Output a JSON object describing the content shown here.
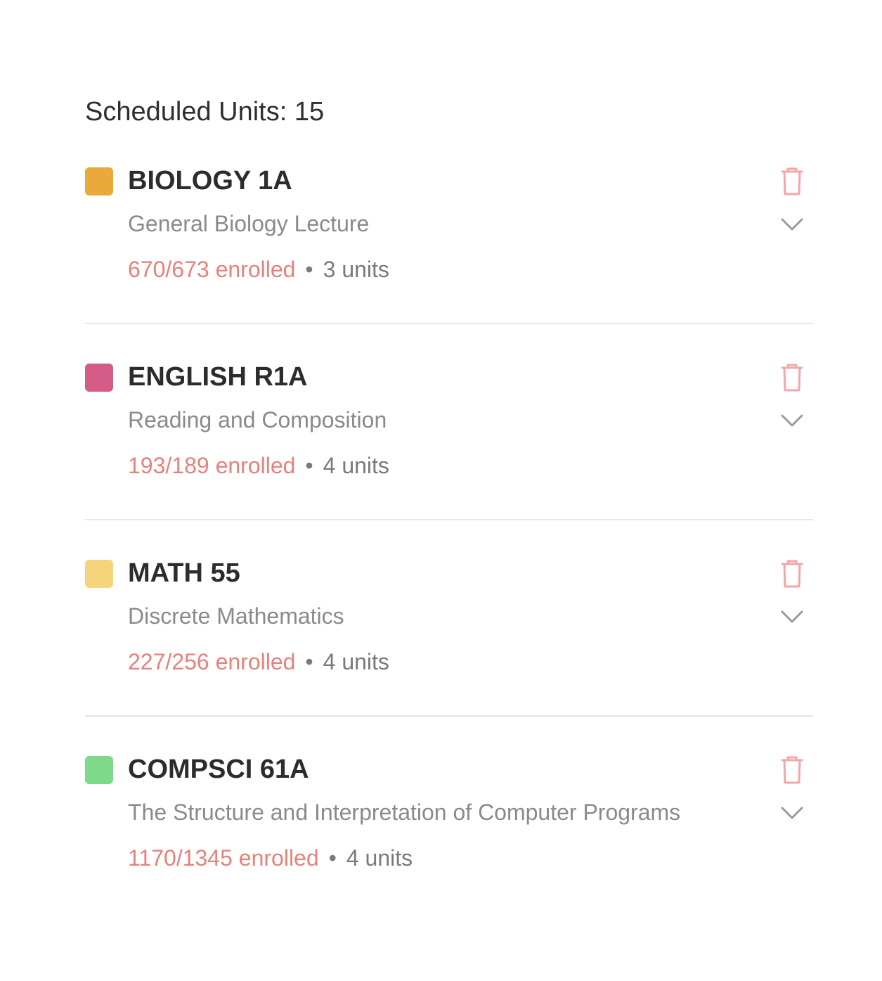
{
  "header": {
    "label": "Scheduled Units: 15"
  },
  "colors": {
    "enrolled": "#e8807b",
    "trash": "#f0a7a5",
    "chevron": "#9a9a9a"
  },
  "courses": [
    {
      "code": "BIOLOGY 1A",
      "title": "General Biology Lecture",
      "enrolled": "670/673 enrolled",
      "separator": "•",
      "units": "3 units",
      "color": "#eba93b",
      "delete_icon": "trash-icon",
      "expand_icon": "chevron-down-icon"
    },
    {
      "code": "ENGLISH R1A",
      "title": "Reading and Composition",
      "enrolled": "193/189 enrolled",
      "separator": "•",
      "units": "4 units",
      "color": "#d45c86",
      "delete_icon": "trash-icon",
      "expand_icon": "chevron-down-icon"
    },
    {
      "code": "MATH 55",
      "title": "Discrete Mathematics",
      "enrolled": "227/256 enrolled",
      "separator": "•",
      "units": "4 units",
      "color": "#f5d47c",
      "delete_icon": "trash-icon",
      "expand_icon": "chevron-down-icon"
    },
    {
      "code": "COMPSCI 61A",
      "title": "The Structure and Interpretation of Computer Programs",
      "enrolled": "1170/1345 enrolled",
      "separator": "•",
      "units": "4 units",
      "color": "#7ed98b",
      "delete_icon": "trash-icon",
      "expand_icon": "chevron-down-icon"
    }
  ]
}
